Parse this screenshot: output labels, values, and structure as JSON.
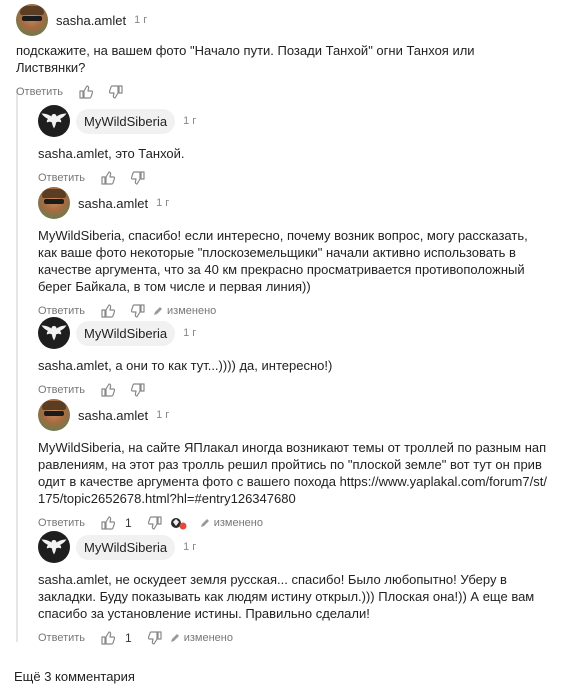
{
  "comments": [
    {
      "author": "sasha.amlet",
      "time": "1 г",
      "text": "подскажите, на вашем фото \"Начало пути. Позади Танхой\" огни Танхоя или Листвянки?",
      "reply": "Ответить"
    },
    {
      "author": "MyWildSiberia",
      "time": "1 г",
      "text": "sasha.amlet, это Танхой.",
      "reply": "Ответить"
    },
    {
      "author": "sasha.amlet",
      "time": "1 г",
      "text": "MyWildSiberia, спасибо! если интересно, почему возник вопрос, могу рассказать, как ваше фото некоторые \"плоскоземельщики\" начали активно использовать в качестве аргумента, что за 40 км прекрасно просматривается противоположный берег Байкала, в том числе и первая линия))",
      "reply": "Ответить",
      "edited": "изменено"
    },
    {
      "author": "MyWildSiberia",
      "time": "1 г",
      "text": "sasha.amlet, а они то как тут...)))) да, интересно!)",
      "reply": "Ответить"
    },
    {
      "author": "sasha.amlet",
      "time": "1 г",
      "text": "MyWildSiberia, на сайте ЯПлакал иногда возникают темы от троллей по разным направлениям, на этот раз тролль решил пройтись по \"плоской земле\" вот тут он приводит в качестве аргумента фото с вашего похода https://www.yaplakal.com/forum7/st/175/topic2652678.html?hl=#entry126347680",
      "reply": "Ответить",
      "likes": "1",
      "edited": "изменено"
    },
    {
      "author": "MyWildSiberia",
      "time": "1 г",
      "text": "sasha.amlet, не оскудеет земля русская... спасибо! Было любопытно! Уберу в закладки. Буду показывать как людям истину открыл.))) Плоская она!)) А еще вам спасибо за установление истины. Правильно сделали!",
      "reply": "Ответить",
      "likes": "1",
      "edited": "изменено"
    }
  ],
  "more_comments": "Ещё 3 комментария",
  "icons": {
    "like": "thumbs-up-icon",
    "dislike": "thumbs-down-icon",
    "edited": "pencil-icon",
    "author_avatar": "eagle-logo",
    "reactions": "reaction-icons"
  }
}
